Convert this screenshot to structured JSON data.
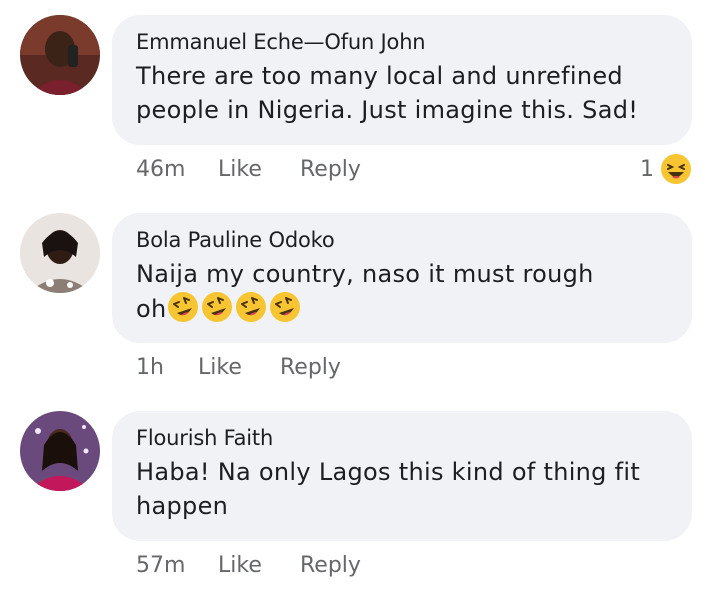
{
  "comments": [
    {
      "author": "Emmanuel Eche—Ofun John",
      "text": "There are too many local and unrefined people in Nigeria. Just imagine this. Sad!",
      "time": "46m",
      "like_label": "Like",
      "reply_label": "Reply",
      "reaction_count": "1",
      "reaction_icon": "laughing-emoji-icon"
    },
    {
      "author": "Bola Pauline Odoko",
      "text_line1": "Naija my country, naso it must rough",
      "text_line2": "oh",
      "emoji_count": 4,
      "emoji_icon": "rolling-laughing-emoji-icon",
      "time": "1h",
      "like_label": "Like",
      "reply_label": "Reply"
    },
    {
      "author": "Flourish Faith",
      "text": "Haba! Na only Lagos this kind of thing fit happen",
      "time": "57m",
      "like_label": "Like",
      "reply_label": "Reply"
    }
  ],
  "colors": {
    "bubble": "#f0f2f5",
    "text": "#1c1e21",
    "meta": "#65676b",
    "emoji": "#f7c531"
  }
}
